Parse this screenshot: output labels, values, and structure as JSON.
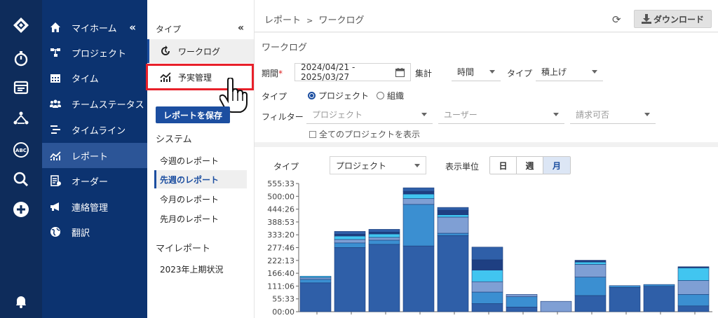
{
  "rail": {
    "icons": [
      "logo-icon",
      "stopwatch-icon",
      "folder-icon",
      "org-icon",
      "abc-icon",
      "search-icon",
      "plus-circle-icon",
      "bell-icon"
    ]
  },
  "nav": {
    "collapse": "«",
    "items": [
      {
        "label": "マイホーム",
        "icon": "home-icon"
      },
      {
        "label": "プロジェクト",
        "icon": "hierarchy-icon"
      },
      {
        "label": "タイム",
        "icon": "calendar-icon"
      },
      {
        "label": "チームステータス",
        "icon": "team-icon"
      },
      {
        "label": "タイムライン",
        "icon": "timeline-icon"
      },
      {
        "label": "レポート",
        "icon": "chart-icon"
      },
      {
        "label": "オーダー",
        "icon": "order-icon"
      },
      {
        "label": "連絡管理",
        "icon": "megaphone-icon"
      },
      {
        "label": "翻訳",
        "icon": "globe-icon"
      }
    ]
  },
  "sub": {
    "heading": "タイプ",
    "collapse": "«",
    "types": [
      {
        "label": "ワークログ",
        "icon": "worklog-icon"
      },
      {
        "label": "予実管理",
        "icon": "chart-icon"
      }
    ],
    "save_label": "レポートを保存",
    "system_label": "システム",
    "system_reports": [
      "今週のレポート",
      "先週のレポート",
      "今月のレポート",
      "先月のレポート"
    ],
    "my_label": "マイレポート",
    "my_reports": [
      "2023年上期状況"
    ]
  },
  "topbar": {
    "crumb_root": "レポート",
    "crumb_sep": ">",
    "crumb_current": "ワークログ",
    "download_label": "ダウンロード"
  },
  "filters": {
    "section_title": "ワークログ",
    "period_label": "期間",
    "required_mark": "*",
    "period_value": "2024/04/21 - 2025/03/27",
    "agg_label": "集計",
    "agg_value": "時間",
    "type_label": "タイプ",
    "type_value": "積上げ",
    "type2_label": "タイプ",
    "radio_project": "プロジェクト",
    "radio_org": "組織",
    "filter_label": "フィルター",
    "project_ph": "プロジェクト",
    "user_ph": "ユーザー",
    "billable_ph": "請求可否",
    "show_all": "全てのプロジェクトを表示"
  },
  "chart_controls": {
    "type_label": "タイプ",
    "type_value": "プロジェクト",
    "unit_label": "表示単位",
    "units": [
      "日",
      "週",
      "月"
    ],
    "active_unit": "月"
  },
  "chart_data": {
    "type": "bar",
    "stacked": true,
    "ylim": [
      0,
      555.55
    ],
    "y_ticks": [
      "00:00",
      "55:33",
      "111:06",
      "166:40",
      "222:13",
      "277:46",
      "333:20",
      "388:53",
      "444:26",
      "500:00",
      "555:33"
    ],
    "categories": [
      "",
      "",
      "",
      "",
      "",
      "",
      "",
      "",
      "",
      "",
      "",
      ""
    ],
    "colors": [
      "#2f5fa8",
      "#3b8fd1",
      "#7f9fd4",
      "#41c5f0",
      "#1e3f82"
    ],
    "bars": [
      [
        125,
        15,
        8,
        6
      ],
      [
        278,
        20,
        15,
        15,
        8,
        12
      ],
      [
        292,
        18,
        12,
        15,
        8,
        12
      ],
      [
        285,
        180,
        25,
        20,
        12,
        15
      ],
      [
        330,
        10,
        70,
        10,
        20,
        12
      ],
      [
        35,
        50,
        45,
        50,
        45,
        55
      ],
      [
        20,
        45,
        10
      ],
      [
        0,
        0,
        45
      ],
      [
        70,
        80,
        55,
        10,
        8
      ],
      [
        105,
        8
      ],
      [
        110,
        8
      ],
      [
        25,
        50,
        60,
        55,
        5
      ]
    ]
  }
}
